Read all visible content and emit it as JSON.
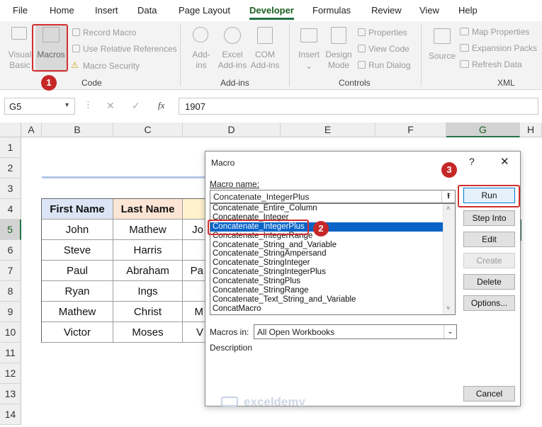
{
  "menubar": {
    "items": [
      "File",
      "Home",
      "Insert",
      "Data",
      "Page Layout",
      "Developer",
      "Formulas",
      "Review",
      "View",
      "Help"
    ],
    "active": "Developer"
  },
  "ribbon": {
    "code": {
      "visual_basic": "Visual Basic",
      "macros": "Macros",
      "record_macro": "Record Macro",
      "use_relative": "Use Relative References",
      "macro_security": "Macro Security",
      "label": "Code"
    },
    "addins": {
      "addins": "Add-ins",
      "excel_addins": "Excel Add-ins",
      "com_addins": "COM Add-ins",
      "label": "Add-ins"
    },
    "controls": {
      "insert": "Insert",
      "design_mode": "Design Mode",
      "properties": "Properties",
      "view_code": "View Code",
      "run_dialog": "Run Dialog",
      "label": "Controls"
    },
    "xml": {
      "source": "Source",
      "map_properties": "Map Properties",
      "expansion_packs": "Expansion Packs",
      "refresh_data": "Refresh Data",
      "label": "XML"
    }
  },
  "formula_bar": {
    "name_box": "G5",
    "fx": "fx",
    "value": "1907"
  },
  "sheet": {
    "columns": [
      "A",
      "B",
      "C",
      "D",
      "E",
      "F",
      "G",
      "H"
    ],
    "rows": [
      "1",
      "2",
      "3",
      "4",
      "5",
      "6",
      "7",
      "8",
      "9",
      "10",
      "11",
      "12",
      "13",
      "14"
    ],
    "table_headers": [
      "First Name",
      "Last Name"
    ],
    "first_names": [
      "John",
      "Steve",
      "Paul",
      "Ryan",
      "Mathew",
      "Victor"
    ],
    "last_names": [
      "Mathew",
      "Harris",
      "Abraham",
      "Ings",
      "Christ",
      "Moses"
    ],
    "partial_d": [
      "Jo",
      "",
      "Pa",
      "",
      "M",
      "V"
    ]
  },
  "dialog": {
    "title": "Macro",
    "help": "?",
    "close": "✕",
    "macro_name_label": "Macro name:",
    "macro_name_value": "Concatenate_IntegerPlus",
    "macros": [
      "Concatenate_Entire_Column",
      "Concatenate_Integer",
      "Concatenate_IntegerPlus",
      "Concatenate_IntegerRange",
      "Concatenate_String_and_Variable",
      "Concatenate_StringAmpersand",
      "Concatenate_StringInteger",
      "Concatenate_StringIntegerPlus",
      "Concatenate_StringPlus",
      "Concatenate_StringRange",
      "Concatenate_Text_String_and_Variable",
      "ConcatMacro"
    ],
    "selected_index": 2,
    "macros_in_label": "Macros in:",
    "macros_in_value": "All Open Workbooks",
    "description_label": "Description",
    "buttons": {
      "run": "Run",
      "step_into": "Step Into",
      "edit": "Edit",
      "create": "Create",
      "delete": "Delete",
      "options": "Options...",
      "cancel": "Cancel"
    }
  },
  "badges": [
    "1",
    "2",
    "3"
  ],
  "watermark": {
    "name": "exceldemy",
    "tagline": "EXCEL · DATA · BI"
  },
  "colors": {
    "accent": "#217346",
    "selection": "#0a64c8",
    "highlight": "#d32f2f",
    "header_blue": "#dbe5f5",
    "header_peach": "#fde5d6"
  }
}
